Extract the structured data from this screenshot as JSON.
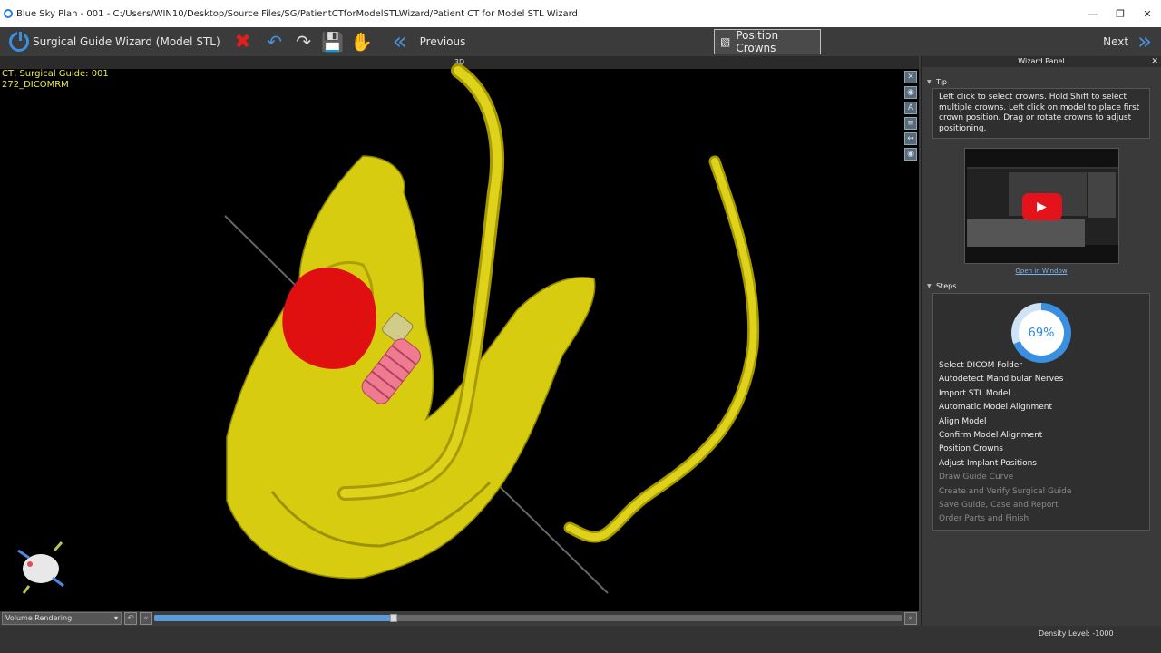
{
  "window": {
    "title": "Blue Sky Plan - 001 - C:/Users/WIN10/Desktop/Source Files/SG/PatientCTforModelSTLWizard/Patient CT for Model STL Wizard"
  },
  "toolbar": {
    "wizard_label": "Surgical Guide Wizard (Model STL)",
    "previous_label": "Previous",
    "position_crowns_label": "Position Crowns",
    "next_label": "Next"
  },
  "viewport": {
    "header": "3D",
    "info_line1": "CT, Surgical Guide: 001",
    "info_line2": "272_DICOMRM",
    "render_mode": "Volume Rendering",
    "slider_position": 0.32
  },
  "panel": {
    "title": "Wizard Panel",
    "tip_label": "Tip",
    "tip_text": "Left click to select crowns. Hold Shift to select multiple crowns. Left click on model to place first crown position. Drag or rotate crowns to adjust positioning.",
    "open_in_window": "Open in Window",
    "steps_label": "Steps",
    "progress": "69%",
    "progress_value": 69,
    "steps": [
      {
        "label": "Select DICOM Folder",
        "state": "done"
      },
      {
        "label": "Autodetect Mandibular Nerves",
        "state": "done"
      },
      {
        "label": "Import STL Model",
        "state": "done"
      },
      {
        "label": "Automatic Model Alignment",
        "state": "done"
      },
      {
        "label": "Align Model",
        "state": "done"
      },
      {
        "label": "Confirm Model Alignment",
        "state": "done"
      },
      {
        "label": "Position Crowns",
        "state": "done"
      },
      {
        "label": "Adjust Implant Positions",
        "state": "done"
      },
      {
        "label": "Draw Guide Curve",
        "state": "pending"
      },
      {
        "label": "Create and Verify Surgical Guide",
        "state": "pending"
      },
      {
        "label": "Save Guide, Case and Report",
        "state": "pending"
      },
      {
        "label": "Order Parts and Finish",
        "state": "pending"
      }
    ]
  },
  "status": {
    "density": "Density Level: -1000"
  },
  "colors": {
    "accent": "#3a8fe0",
    "model": "#e0d21c",
    "crown": "#e01010",
    "implant": "#f07a90"
  }
}
